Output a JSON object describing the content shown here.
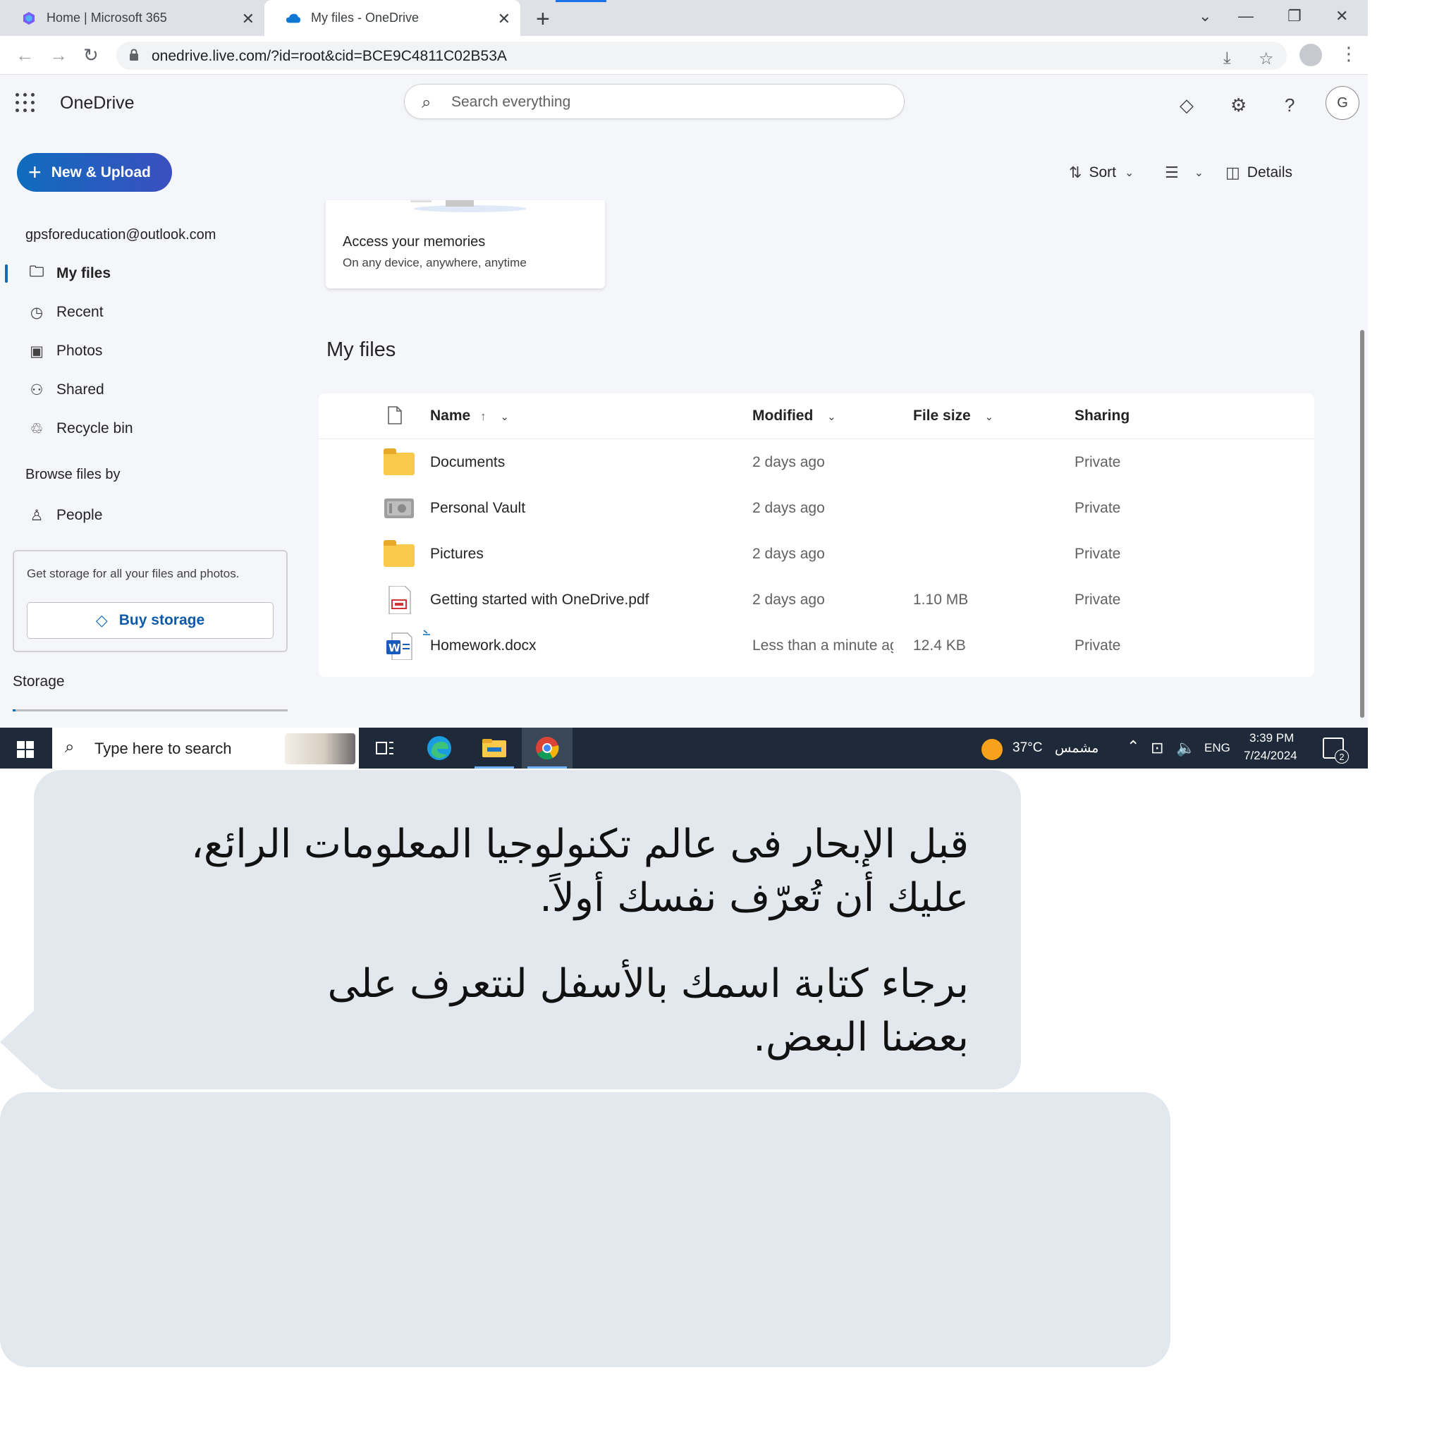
{
  "browser": {
    "tabs": [
      {
        "title": "Home | Microsoft 365",
        "close": "✕"
      },
      {
        "title": "My files - OneDrive",
        "close": "✕"
      }
    ],
    "new_tab": "+",
    "window_controls": {
      "tabsearch": "⌄",
      "minimize": "—",
      "restore": "❐",
      "close": "✕"
    },
    "url": "onedrive.live.com/?id=root&cid=BCE9C4811C02B53A",
    "icons": {
      "back": "←",
      "forward": "→",
      "reload": "↻",
      "download": "⤓",
      "star": "☆",
      "menu": "⋮"
    }
  },
  "onedrive": {
    "brand": "OneDrive",
    "search_placeholder": "Search everything",
    "new_upload": "New & Upload",
    "account": "gpsforeducation@outlook.com",
    "nav": [
      {
        "label": "My files",
        "icon": "folder-icon",
        "glyph": "🗀"
      },
      {
        "label": "Recent",
        "icon": "clock-icon",
        "glyph": "◷"
      },
      {
        "label": "Photos",
        "icon": "image-icon",
        "glyph": "▣"
      },
      {
        "label": "Shared",
        "icon": "people-icon",
        "glyph": "⚇"
      },
      {
        "label": "Recycle bin",
        "icon": "recycle-bin-icon",
        "glyph": "♲"
      }
    ],
    "browse_label": "Browse files by",
    "browse_people": "People",
    "storage_promo": "Get storage for all your files and photos.",
    "buy_storage": "Buy storage",
    "storage_label": "Storage",
    "toolbar": {
      "sort": "Sort",
      "details": "Details"
    },
    "memories": {
      "title": "Access your memories",
      "subtitle": "On any device, anywhere, anytime"
    },
    "section_title": "My files",
    "columns": {
      "name": "Name",
      "modified": "Modified",
      "size": "File size",
      "sharing": "Sharing"
    },
    "files": [
      {
        "name": "Documents",
        "type": "folder",
        "modified": "2 days ago",
        "size": "",
        "sharing": "Private"
      },
      {
        "name": "Personal Vault",
        "type": "vault",
        "modified": "2 days ago",
        "size": "",
        "sharing": "Private"
      },
      {
        "name": "Pictures",
        "type": "folder",
        "modified": "2 days ago",
        "size": "",
        "sharing": "Private"
      },
      {
        "name": "Getting started with OneDrive.pdf",
        "type": "pdf",
        "modified": "2 days ago",
        "size": "1.10 MB",
        "sharing": "Private"
      },
      {
        "name": "Homework.docx",
        "type": "docx",
        "modified": "Less than a minute ag",
        "size": "12.4 KB",
        "sharing": "Private"
      }
    ]
  },
  "taskbar": {
    "search_placeholder": "Type here to search",
    "temperature": "37°C",
    "weather": "مشمس",
    "language": "ENG",
    "time": "3:39 PM",
    "date": "7/24/2024",
    "notifications": "2"
  },
  "message": {
    "paragraph1_line1": "قبل الإبحار فى عالم تكنولوجيا المعلومات  الرائع،",
    "paragraph1_line2": "عليك أن تُعرّف نفسك أولاً.",
    "paragraph2_line1": "برجاء كتابة اسمك بالأسفل لنتعرف على",
    "paragraph2_line2": "بعضنا البعض."
  },
  "colors": {
    "accent": "#0f6cbd",
    "folder": "#f8c94a",
    "taskbar": "#1e2a3a",
    "bubble": "#e3e7ee"
  }
}
